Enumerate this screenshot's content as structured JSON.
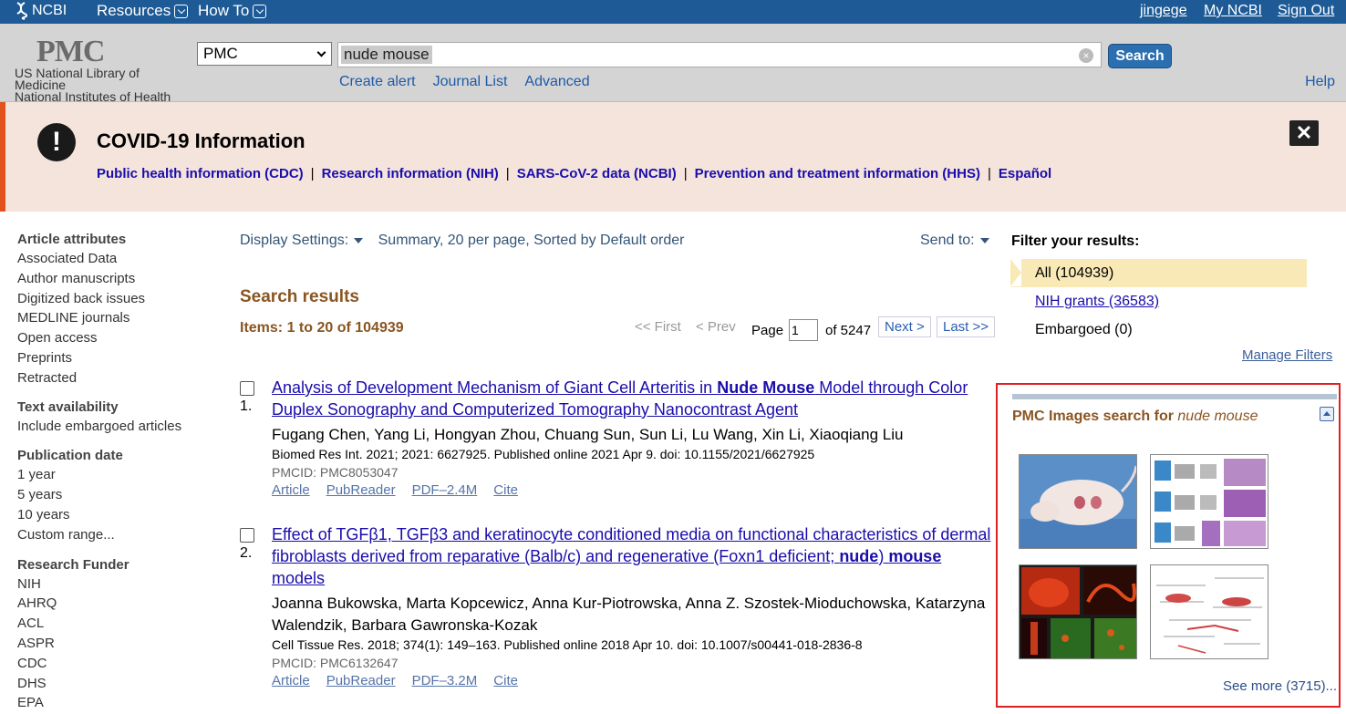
{
  "topbar": {
    "brand": "NCBI",
    "resources": "Resources",
    "howto": "How To",
    "user": "jingege",
    "myncbi": "My NCBI",
    "signout": "Sign Out"
  },
  "header": {
    "logo": "PMC",
    "lib_line1": "US National Library of",
    "lib_line2": "Medicine",
    "lib_line3": "National Institutes of Health",
    "db": "PMC",
    "query": "nude mouse",
    "search_label": "Search",
    "links": [
      "Create alert",
      "Journal List",
      "Advanced"
    ],
    "help": "Help"
  },
  "covid": {
    "title": "COVID-19 Information",
    "links": [
      "Public health information (CDC)",
      "Research information (NIH)",
      "SARS-CoV-2 data (NCBI)",
      "Prevention and treatment information (HHS)",
      "Español"
    ]
  },
  "sidebar": {
    "sections": [
      {
        "heading": "Article attributes",
        "items": [
          "Associated Data",
          "Author manuscripts",
          "Digitized back issues",
          "MEDLINE journals",
          "Open access",
          "Preprints",
          "Retracted"
        ]
      },
      {
        "heading": "Text availability",
        "items": [
          "Include embargoed articles"
        ]
      },
      {
        "heading": "Publication date",
        "items": [
          "1 year",
          "5 years",
          "10 years",
          "Custom range..."
        ]
      },
      {
        "heading": "Research Funder",
        "items": [
          "NIH",
          "AHRQ",
          "ACL",
          "ASPR",
          "CDC",
          "DHS",
          "EPA"
        ]
      }
    ]
  },
  "display": {
    "settings_label": "Display Settings:",
    "summary": "Summary, 20 per page, Sorted by Default order",
    "sendto": "Send to:"
  },
  "results": {
    "heading": "Search results",
    "items": "Items: 1 to 20 of 104939",
    "pager": {
      "first": "<< First",
      "prev": "< Prev",
      "page_label": "Page",
      "page": "1",
      "of": "of 5247",
      "next": "Next >",
      "last": "Last >>"
    },
    "list": [
      {
        "num": "1.",
        "title_a": "Analysis of Development Mechanism of Giant Cell Arteritis in ",
        "title_b": "Nude Mouse",
        "title_c": " Model through Color Duplex Sonography and Computerized Tomography Nanocontrast Agent",
        "authors": "Fugang Chen, Yang Li, Hongyan Zhou, Chuang Sun, Sun Li, Lu Wang, Xin Li, Xiaoqiang Liu",
        "citation": "Biomed Res Int. 2021; 2021: 6627925. Published online 2021 Apr 9. doi: 10.1155/2021/6627925",
        "pmcid": "PMCID: PMC8053047",
        "links": [
          "Article",
          "PubReader",
          "PDF–2.4M",
          "Cite"
        ]
      },
      {
        "num": "2.",
        "title_a": "Effect of TGFβ1, TGFβ3 and keratinocyte conditioned media on functional characteristics of dermal fibroblasts derived from reparative (Balb/c) and regenerative (Foxn1 deficient; ",
        "title_b": "nude",
        "title_c": ") ",
        "title_d": "mouse",
        "title_e": " models",
        "authors": "Joanna Bukowska, Marta Kopcewicz, Anna Kur-Piotrowska, Anna Z. Szostek-Mioduchowska, Katarzyna Walendzik, Barbara Gawronska-Kozak",
        "citation": "Cell Tissue Res. 2018; 374(1): 149–163. Published online 2018 Apr 10. doi: 10.1007/s00441-018-2836-8",
        "pmcid": "PMCID: PMC6132647",
        "links": [
          "Article",
          "PubReader",
          "PDF–3.2M",
          "Cite"
        ]
      }
    ]
  },
  "filters": {
    "heading": "Filter your results:",
    "all": "All (104939)",
    "nih": "NIH grants (36583)",
    "embargoed": "Embargoed (0)",
    "manage": "Manage Filters"
  },
  "images": {
    "title": "PMC Images search for ",
    "query": "nude mouse",
    "seemore": "See more (3715)..."
  }
}
